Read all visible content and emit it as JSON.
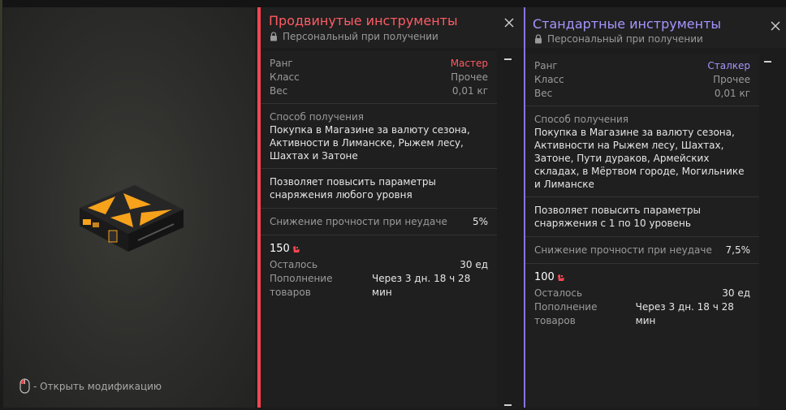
{
  "preview": {
    "hint_label": "- Открыть модификацию"
  },
  "advanced": {
    "title": "Продвинутые инструменты",
    "subtitle": "Персональный при получении",
    "rank_label": "Ранг",
    "rank_value": "Мастер",
    "class_label": "Класс",
    "class_value": "Прочее",
    "weight_label": "Вес",
    "weight_value": "0,01 кг",
    "source_label": "Способ получения",
    "source_text": "Покупка в Магазине за валюту сезона, Активности в Лиманске, Рыжем лесу, Шахтах и Затоне",
    "description": "Позволяет повысить параметры снаряжения любого уровня",
    "durability_label": "Снижение прочности при неудаче",
    "durability_value": "5%",
    "price": "150",
    "remaining_label": "Осталось",
    "remaining_value": "30 ед",
    "restock_label": "Пополнение товаров",
    "restock_value": "Через 3 дн. 18 ч 28 мин",
    "accent_color": "#ff4651"
  },
  "standard": {
    "title": "Стандартные инструменты",
    "subtitle": "Персональный при получении",
    "rank_label": "Ранг",
    "rank_value": "Сталкер",
    "class_label": "Класс",
    "class_value": "Прочее",
    "weight_label": "Вес",
    "weight_value": "0,01 кг",
    "source_label": "Способ получения",
    "source_text": "Покупка в Магазине за валюту сезона, Активности на Рыжем лесу, Шахтах, Затоне, Пути дураков, Армейских складах, в Мёртвом городе, Могильнике и Лиманске",
    "description": "Позволяет повысить параметры снаряжения с 1 по 10 уровень",
    "durability_label": "Снижение прочности при неудаче",
    "durability_value": "7,5%",
    "price": "100",
    "remaining_label": "Осталось",
    "remaining_value": "30 ед",
    "restock_label": "Пополнение товаров",
    "restock_value": "Через 3 дн. 18 ч 28 мин",
    "accent_color": "#8b74e0"
  }
}
